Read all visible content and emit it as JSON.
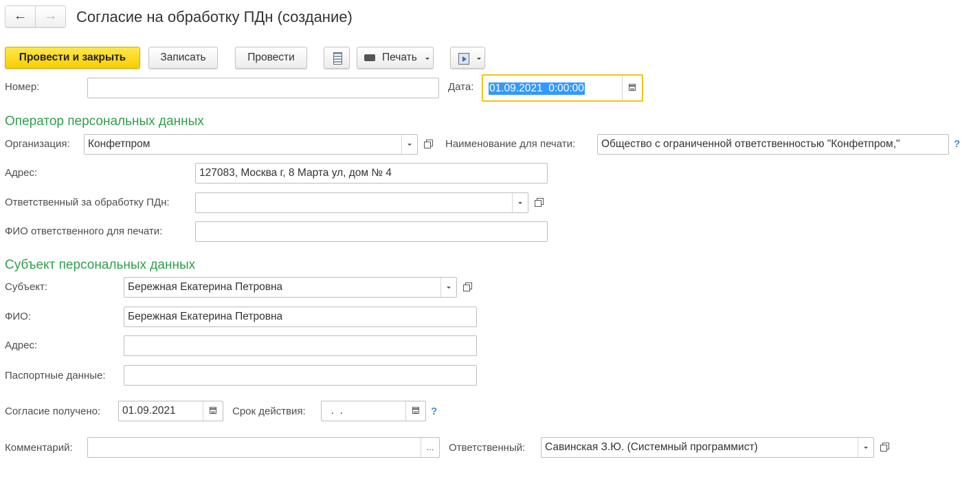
{
  "window": {
    "title": "Согласие на обработку ПДн (создание)"
  },
  "nav": {
    "back_icon": "←",
    "forward_icon": "→"
  },
  "toolbar": {
    "post_close_label": "Провести и закрыть",
    "save_label": "Записать",
    "post_label": "Провести",
    "print_label": "Печать"
  },
  "header": {
    "number_label": "Номер:",
    "number_value": "",
    "date_label": "Дата:",
    "date_value": "01.09.2021  0:00:00"
  },
  "operator": {
    "section_title": "Оператор персональных данных",
    "org_label": "Организация:",
    "org_value": "Конфетпром",
    "print_name_label": "Наименование для печати:",
    "print_name_value": "Общество с ограниченной ответственностью \"Конфетпром,\"",
    "address_label": "Адрес:",
    "address_value": "127083, Москва г, 8 Марта ул, дом № 4",
    "responsible_label": "Ответственный за обработку ПДн:",
    "responsible_value": "",
    "responsible_fio_label": "ФИО ответственного для печати:",
    "responsible_fio_value": ""
  },
  "subject": {
    "section_title": "Субъект персональных данных",
    "subject_label": "Субъект:",
    "subject_value": "Бережная Екатерина Петровна",
    "fio_label": "ФИО:",
    "fio_value": "Бережная Екатерина Петровна",
    "address_label": "Адрес:",
    "address_value": "",
    "passport_label": "Паспортные данные:",
    "passport_value": ""
  },
  "consent": {
    "received_label": "Согласие получено:",
    "received_value": "01.09.2021",
    "validity_label": "Срок действия:",
    "validity_value": "  .  ."
  },
  "footer": {
    "comment_label": "Комментарий:",
    "comment_value": "",
    "comment_btn": "...",
    "responsible_label": "Ответственный:",
    "responsible_value": "Савинская З.Ю. (Системный программист)"
  },
  "help_icon": "?",
  "colors": {
    "accent_section": "#2e9f4b",
    "primary_button": "#f6cf00",
    "focus_border": "#f0c419",
    "help": "#3a8fd8",
    "selection": "#3399ff"
  }
}
